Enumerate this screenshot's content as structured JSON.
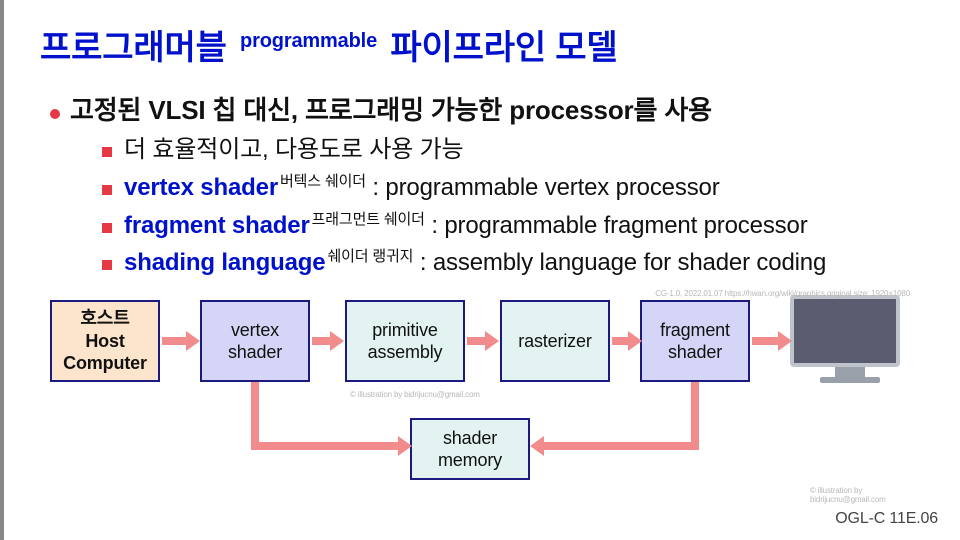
{
  "title": {
    "part1": "프로그래머블",
    "super": "programmable",
    "part2": "파이프라인 모델"
  },
  "main_bullet": "고정된 VLSI 칩 대신, 프로그래밍 가능한 processor를 사용",
  "subs": [
    {
      "type": "plain",
      "text": "더 효율적이고, 다용도로 사용 가능"
    },
    {
      "type": "term",
      "term": "vertex shader",
      "ruby": "버텍스 쉐이더",
      "desc": ": programmable vertex processor"
    },
    {
      "type": "term",
      "term": "fragment shader",
      "ruby": "프래그먼트 쉐이더",
      "desc": ": programmable fragment processor"
    },
    {
      "type": "term",
      "term": "shading language",
      "ruby": "쉐이더 랭귀지",
      "desc": ": assembly language for shader coding"
    }
  ],
  "boxes": {
    "host": {
      "line1": "호스트",
      "line2": "Host",
      "line3": "Computer"
    },
    "vs": {
      "line1": "vertex",
      "line2": "shader"
    },
    "pa": {
      "line1": "primitive",
      "line2": "assembly"
    },
    "ras": {
      "line1": "rasterizer"
    },
    "fs": {
      "line1": "fragment",
      "line2": "shader"
    },
    "sm": {
      "line1": "shader",
      "line2": "memory"
    }
  },
  "credits": {
    "c1": "© illustration by bidrijucnu@gmail.com",
    "c2": "© illustration by bidrijucnu@gmail.com",
    "c3": "CG-1.0, 2022.01.07\nhttps://hwan.org/wiki/graphics\noriginal size: 1920×1080"
  },
  "footer": "OGL-C 11E.06"
}
